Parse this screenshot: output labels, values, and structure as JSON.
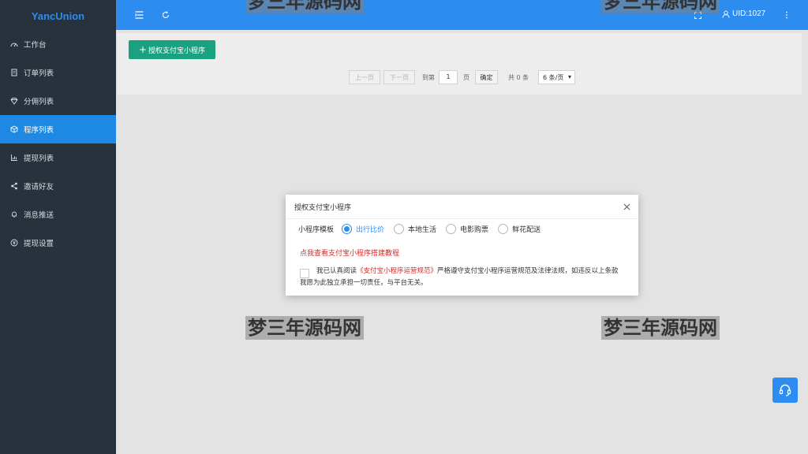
{
  "brand": "YancUnion",
  "sidebar": {
    "items": [
      {
        "label": "工作台",
        "icon": "dashboard-icon"
      },
      {
        "label": "订单列表",
        "icon": "order-icon"
      },
      {
        "label": "分佣列表",
        "icon": "diamond-icon"
      },
      {
        "label": "程序列表",
        "icon": "cube-icon",
        "active": true
      },
      {
        "label": "提现列表",
        "icon": "chart-icon"
      },
      {
        "label": "邀请好友",
        "icon": "share-icon"
      },
      {
        "label": "消息推送",
        "icon": "bell-icon"
      },
      {
        "label": "提现设置",
        "icon": "settings-icon"
      }
    ]
  },
  "header": {
    "user": "UID:1027",
    "icons": [
      "menu-toggle-icon",
      "refresh-icon",
      "fullscreen-icon",
      "user-icon",
      "more-icon"
    ]
  },
  "toolbar": {
    "add_label": "授权支付宝小程序"
  },
  "pager": {
    "prev": "上一页",
    "next": "下一页",
    "goto_prefix": "到第",
    "page_value": "1",
    "page_suffix": "页",
    "confirm": "确定",
    "total": "共 0 条",
    "page_size": "6 条/页"
  },
  "watermark": "梦三年源码网",
  "dialog": {
    "title": "授权支付宝小程序",
    "template_label": "小程序模板",
    "options": [
      "出行比价",
      "本地生活",
      "电影购票",
      "鲜花配送"
    ],
    "selected_index": 0,
    "tutorial_link": "点我查看支付宝小程序搭建教程",
    "agree_prefix": "我已认真阅读",
    "agree_link": "《支付宝小程序运营规范》",
    "agree_suffix": "严格遵守支付宝小程序运营规范及法律法规，如违反以上条款",
    "agree_line2": "我愿为此独立承担一切责任，与平台无关。"
  },
  "colors": {
    "primary": "#2d8cf0",
    "sidebar_bg": "#28323c",
    "add_button": "#1aa180",
    "link_red": "#d52b2b"
  }
}
